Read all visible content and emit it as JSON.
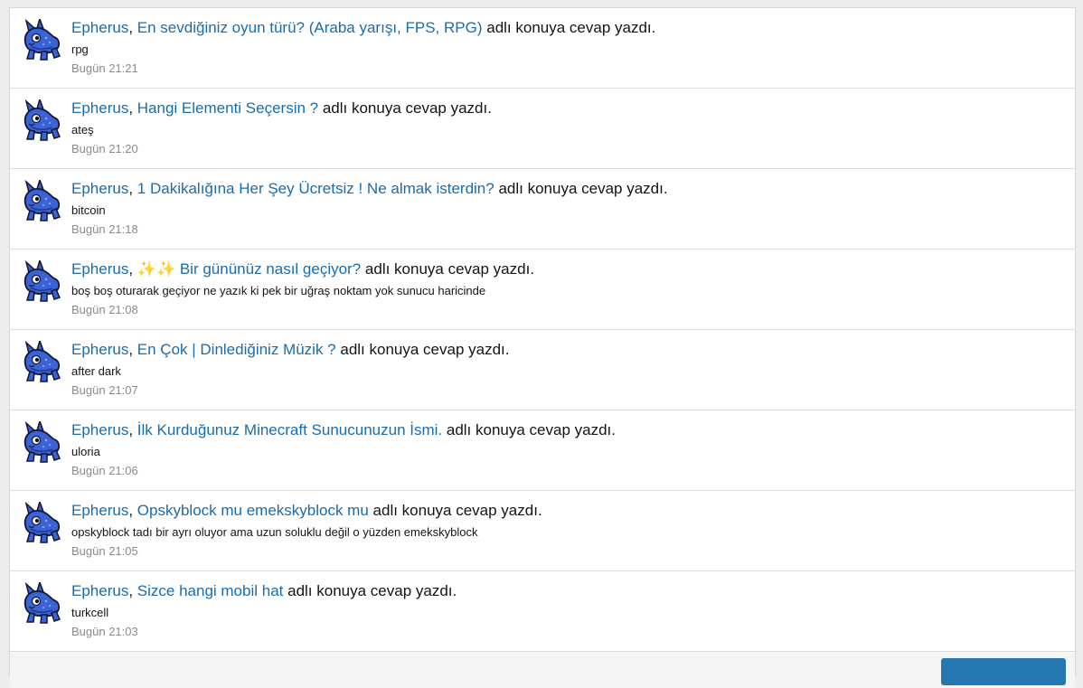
{
  "activity": {
    "action_text": "adlı konuya cevap yazdı.",
    "items": [
      {
        "user": "Epherus",
        "thread": "En sevdiğiniz oyun türü? (Araba yarışı, FPS, RPG)",
        "snippet": "rpg",
        "time": "Bugün 21:21"
      },
      {
        "user": "Epherus",
        "thread": "Hangi Elementi Seçersin ?",
        "snippet": "ateş",
        "time": "Bugün 21:20"
      },
      {
        "user": "Epherus",
        "thread": "1 Dakikalığına Her Şey Ücretsiz ! Ne almak isterdin?",
        "snippet": "bitcoin",
        "time": "Bugün 21:18"
      },
      {
        "user": "Epherus",
        "thread": "✨✨ Bir gününüz nasıl geçiyor?",
        "snippet": "boş boş oturarak geçiyor ne yazık ki pek bir uğraş noktam yok sunucu haricinde",
        "time": "Bugün 21:08"
      },
      {
        "user": "Epherus",
        "thread": "En Çok | Dinlediğiniz Müzik ?",
        "snippet": "after dark",
        "time": "Bugün 21:07"
      },
      {
        "user": "Epherus",
        "thread": "İlk Kurduğunuz Minecraft Sunucunuzun İsmi.",
        "snippet": "uloria",
        "time": "Bugün 21:06"
      },
      {
        "user": "Epherus",
        "thread": "Opskyblock mu emekskyblock mu",
        "snippet": "opskyblock tadı bir ayrı oluyor ama uzun soluklu değil o yüzden emekskyblock",
        "time": "Bugün 21:05"
      },
      {
        "user": "Epherus",
        "thread": "Sizce hangi mobil hat",
        "snippet": "turkcell",
        "time": "Bugün 21:03"
      }
    ]
  },
  "colors": {
    "link": "#1a6cad",
    "text": "#141414",
    "muted": "#8a8a8a",
    "button": "#2577b1"
  },
  "icons": {
    "avatar": "blue-creature-avatar-icon"
  }
}
